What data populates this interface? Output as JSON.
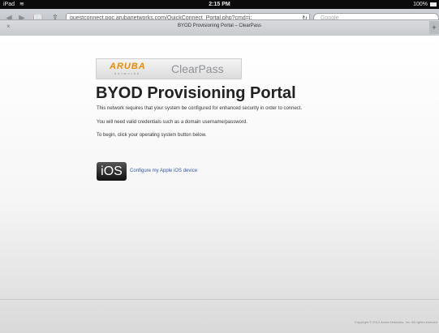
{
  "statusbar": {
    "carrier": "iPad",
    "wifi_icon": "wifi-icon",
    "time": "2:15 PM",
    "battery_label": "100%"
  },
  "browser": {
    "back_icon": "back-arrow-icon",
    "forward_icon": "forward-arrow-icon",
    "bookmarks_icon": "bookmarks-book-icon",
    "share_icon": "share-icon",
    "url": "guestconnect.poc.arubanetworks.com/QuickConnect_Portal.php?cmd=i:",
    "reload_icon": "reload-icon",
    "search_placeholder": "Google",
    "tab_title": "BYOD Provisioning Portal – ClearPass",
    "tab_close": "×",
    "new_tab": "+"
  },
  "logo": {
    "aruba": "ARUBA",
    "aruba_sub": "networks",
    "product": "ClearPass"
  },
  "page": {
    "title": "BYOD Provisioning Portal",
    "para1": "This network requires that your system be configured for enhanced security in order to connect.",
    "para2": "You will need valid credentials such as a domain username/password.",
    "para3": "To begin, click your operating system button below.",
    "os_button": "iOS",
    "os_link": "Configure my Apple iOS device",
    "copyright": "Copyright © 2012 Aruba Networks, Inc. All rights reserved"
  },
  "colors": {
    "aruba_orange": "#f08a00",
    "link_blue": "#3456b0",
    "status_bar": "#0b0b0b"
  }
}
